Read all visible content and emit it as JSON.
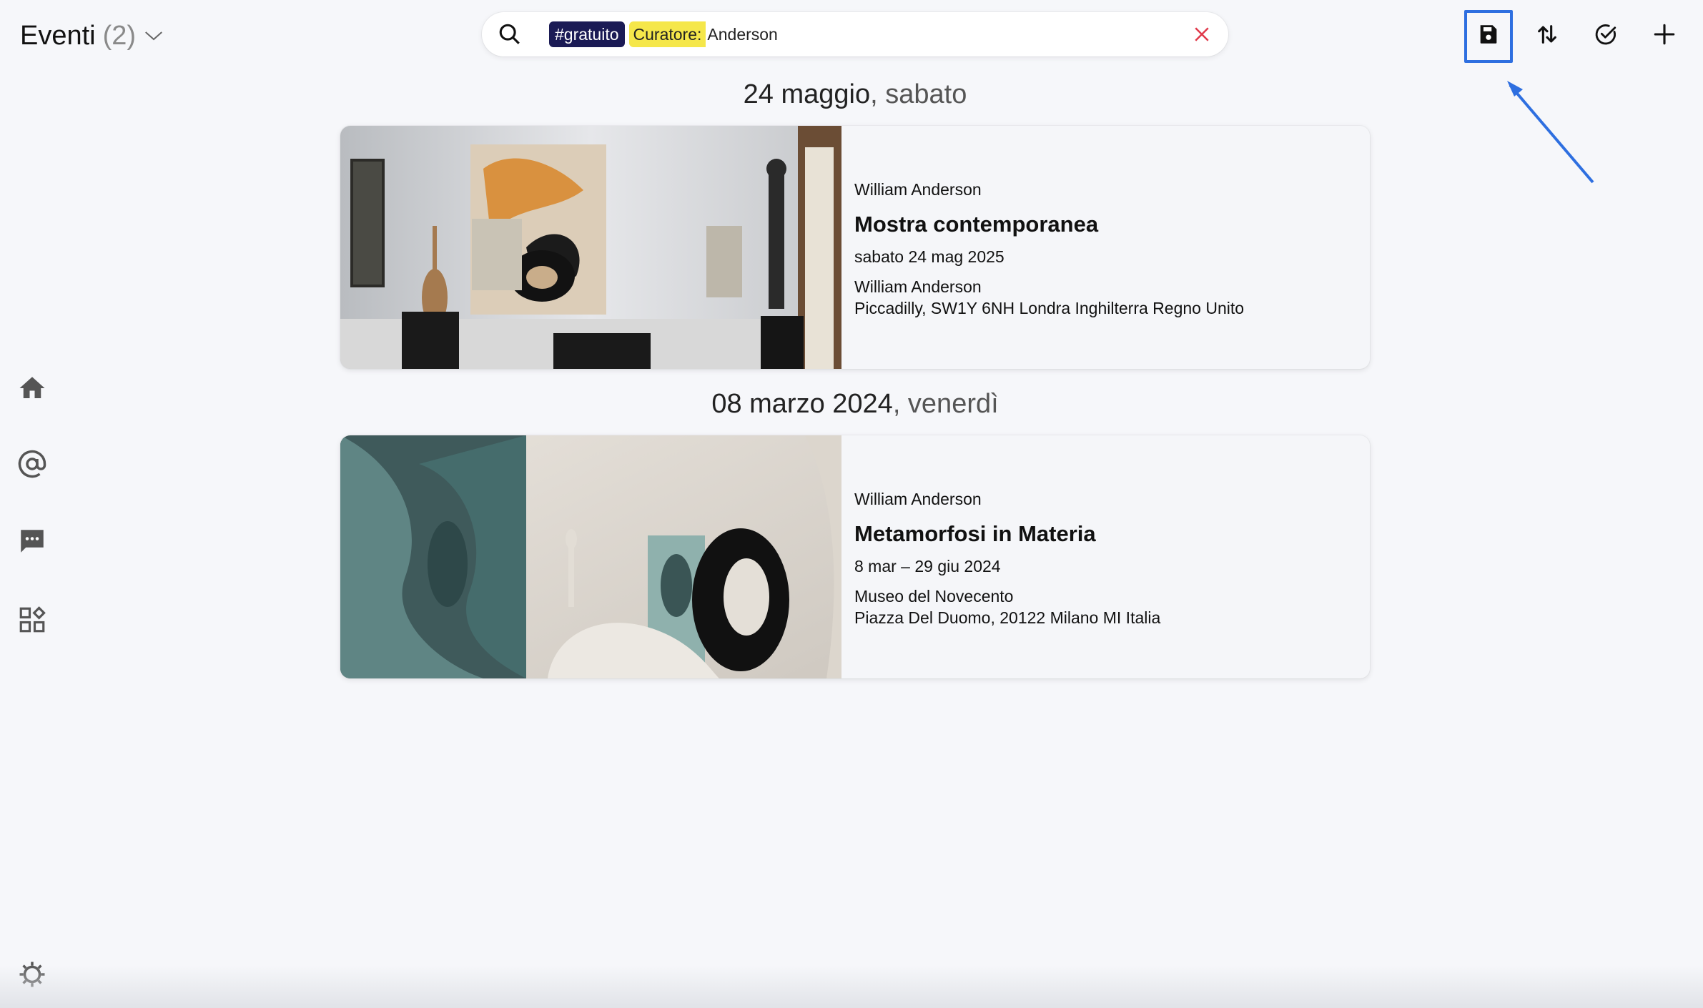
{
  "header": {
    "title": "Eventi",
    "count": "(2)"
  },
  "search": {
    "hashtag": "#gratuito",
    "filter_key": "Curatore:",
    "filter_value": "Anderson"
  },
  "toolbar": {
    "buttons": [
      "save-icon",
      "sort-icon",
      "select-icon",
      "add-icon"
    ],
    "highlight_color": "#2e6fe0"
  },
  "sidebar": {
    "items": [
      "home-icon",
      "mentions-icon",
      "chat-icon",
      "apps-icon"
    ],
    "footer": "settings-icon"
  },
  "sections": [
    {
      "date": "24 maggio",
      "weekday": ", sabato",
      "event": {
        "organizer": "William Anderson",
        "title": "Mostra contemporanea",
        "date": "sabato 24 mag 2025",
        "venue": "William Anderson",
        "address": "Piccadilly, SW1Y 6NH Londra Inghilterra Regno Unito"
      }
    },
    {
      "date": "08 marzo 2024",
      "weekday": ", venerdì",
      "event": {
        "organizer": "William Anderson",
        "title": "Metamorfosi in Materia",
        "date": "8 mar – 29 giu 2024",
        "venue": "Museo del Novecento",
        "address": "Piazza Del Duomo, 20122 Milano MI Italia"
      }
    }
  ]
}
